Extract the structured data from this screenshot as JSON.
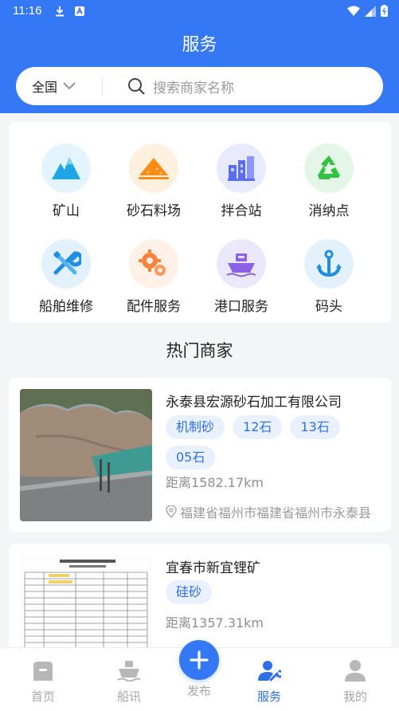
{
  "status": {
    "time": "11:16"
  },
  "header": {
    "title": "服务"
  },
  "search": {
    "region": "全国",
    "placeholder": "搜索商家名称"
  },
  "categories": [
    {
      "label": "矿山",
      "icon": "mountain-icon",
      "bg": "#e3f4fc"
    },
    {
      "label": "砂石料场",
      "icon": "sand-pile-icon",
      "bg": "#fff0e0"
    },
    {
      "label": "拌合站",
      "icon": "factory-icon",
      "bg": "#e8ebff"
    },
    {
      "label": "消纳点",
      "icon": "recycle-icon",
      "bg": "#e4f7e6"
    },
    {
      "label": "船舶维修",
      "icon": "wrench-screwdriver-icon",
      "bg": "#e3f1fc"
    },
    {
      "label": "配件服务",
      "icon": "gears-icon",
      "bg": "#fff0e8"
    },
    {
      "label": "港口服务",
      "icon": "ship-icon",
      "bg": "#ece8fb"
    },
    {
      "label": "码头",
      "icon": "anchor-icon",
      "bg": "#e3f1fc"
    }
  ],
  "section": {
    "title": "热门商家"
  },
  "merchants": [
    {
      "name": "永泰县宏源砂石加工有限公司",
      "tags": [
        "机制砂",
        "12石",
        "13石",
        "05石"
      ],
      "distance": "距离1582.17km",
      "address": "福建省福州市福建省福州市永泰县"
    },
    {
      "name": "宜春市新宜锂矿",
      "tags": [
        "硅砂"
      ],
      "distance": "距离1357.31km"
    }
  ],
  "nav": {
    "home": "首页",
    "news": "船讯",
    "publish": "发布",
    "service": "服务",
    "mine": "我的"
  },
  "colors": {
    "primary": "#3478f6",
    "tag_bg": "#e9f1ff",
    "tag_text": "#2f6fe8"
  }
}
